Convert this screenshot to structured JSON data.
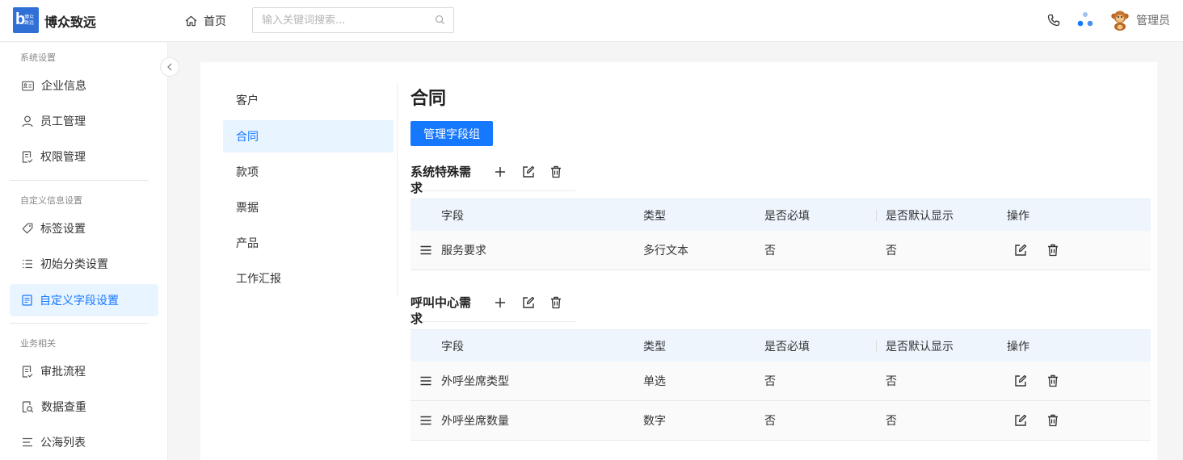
{
  "header": {
    "logo_big": "b",
    "logo_small": "博众致远",
    "brand": "博众致远",
    "home_label": "首页",
    "search_placeholder": "输入关键词搜索...",
    "user_name": "管理员"
  },
  "sidebar": {
    "sections": [
      {
        "title": "系统设置",
        "items": [
          {
            "label": "企业信息",
            "icon": "id-card-icon"
          },
          {
            "label": "员工管理",
            "icon": "user-icon"
          },
          {
            "label": "权限管理",
            "icon": "document-icon"
          }
        ]
      },
      {
        "title": "自定义信息设置",
        "items": [
          {
            "label": "标签设置",
            "icon": "tag-icon"
          },
          {
            "label": "初始分类设置",
            "icon": "list-icon"
          },
          {
            "label": "自定义字段设置",
            "icon": "form-icon",
            "active": true
          }
        ]
      },
      {
        "title": "业务相关",
        "items": [
          {
            "label": "审批流程",
            "icon": "approval-icon"
          },
          {
            "label": "数据查重",
            "icon": "search-doc-icon"
          },
          {
            "label": "公海列表",
            "icon": "sort-list-icon"
          }
        ]
      }
    ]
  },
  "categories": [
    "客户",
    "合同",
    "款项",
    "票据",
    "产品",
    "工作汇报"
  ],
  "active_category": "合同",
  "main": {
    "title": "合同",
    "manage_button": "管理字段组",
    "columns": [
      "字段",
      "类型",
      "是否必填",
      "是否默认显示",
      "操作"
    ],
    "groups": [
      {
        "title": "系统特殊需求",
        "rows": [
          {
            "field": "服务要求",
            "type": "多行文本",
            "required": "否",
            "default_show": "否"
          }
        ]
      },
      {
        "title": "呼叫中心需求",
        "rows": [
          {
            "field": "外呼坐席类型",
            "type": "单选",
            "required": "否",
            "default_show": "否"
          },
          {
            "field": "外呼坐席数量",
            "type": "数字",
            "required": "否",
            "default_show": "否"
          }
        ]
      }
    ]
  },
  "colors": {
    "primary": "#1677ff",
    "active_bg": "#e8f4ff",
    "table_head_bg": "#eef5fd",
    "logo_bg": "#2f6fd6"
  }
}
